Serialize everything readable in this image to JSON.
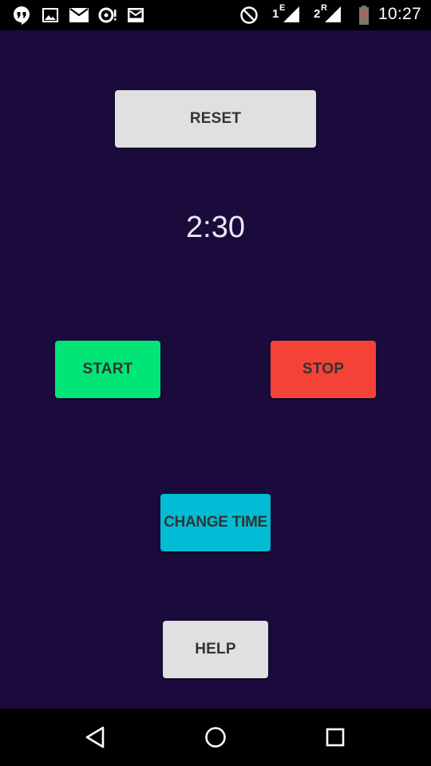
{
  "status_bar": {
    "time": "10:27",
    "sim1_label": "1",
    "sim1_type": "E",
    "sim2_label": "2",
    "sim2_type": "R",
    "icons": [
      "hangouts-icon",
      "image-icon",
      "gmail-icon",
      "sync-alert-icon",
      "inbox-icon",
      "do-not-disturb-icon",
      "signal-icon",
      "signal-icon",
      "battery-low-icon"
    ],
    "battery_alert_color": "#f44336"
  },
  "app": {
    "background_color": "#1b0b3c",
    "reset_label": "RESET",
    "timer_value": "2:30",
    "start_label": "START",
    "stop_label": "STOP",
    "change_time_label": "CHANGE TIME",
    "help_label": "HELP",
    "colors": {
      "reset": "#e0e0e0",
      "start": "#00e676",
      "stop": "#f44336",
      "change_time": "#00bcd4",
      "help": "#e0e0e0"
    }
  },
  "nav_bar": {
    "buttons": [
      "back-icon",
      "home-icon",
      "recents-icon"
    ]
  }
}
